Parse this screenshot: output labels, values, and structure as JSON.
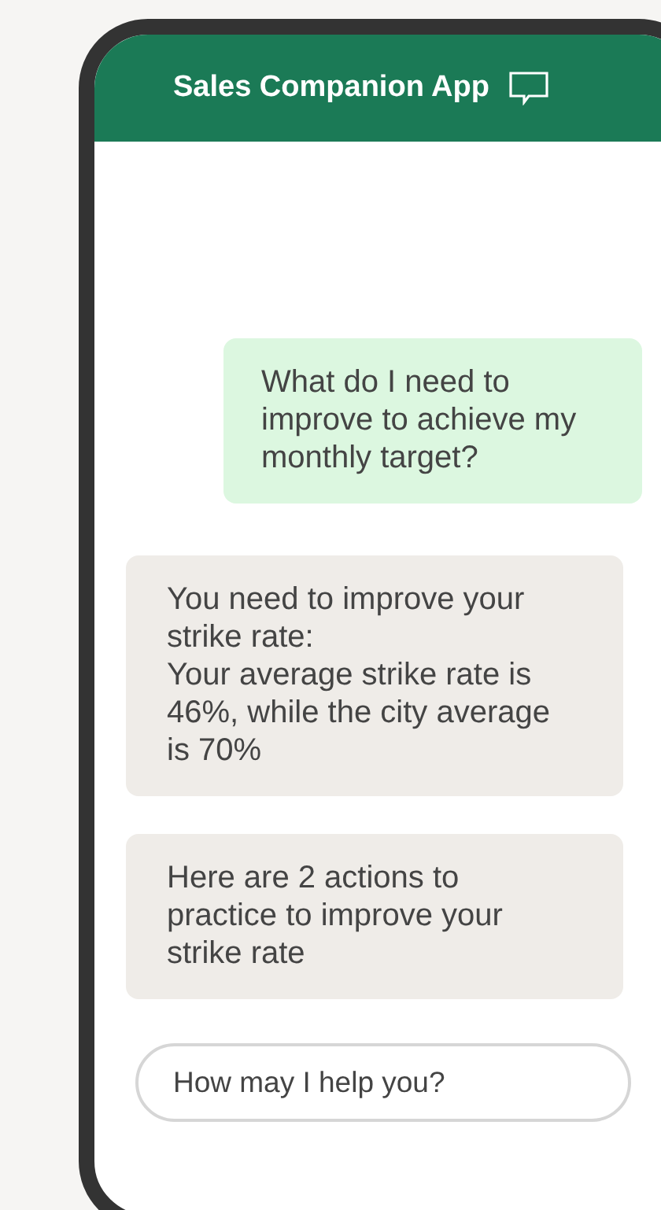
{
  "header": {
    "title": "Sales Companion App"
  },
  "messages": [
    {
      "kind": "outgoing",
      "text": "What do I need to improve to achieve my monthly target?"
    },
    {
      "kind": "incoming",
      "text": "You need to improve your strike rate:\nYour average strike rate is 46%, while the city average is 70%"
    },
    {
      "kind": "incoming",
      "text": "Here are 2 actions to practice to improve your strike rate"
    }
  ],
  "input": {
    "placeholder": "How may I help you?"
  }
}
